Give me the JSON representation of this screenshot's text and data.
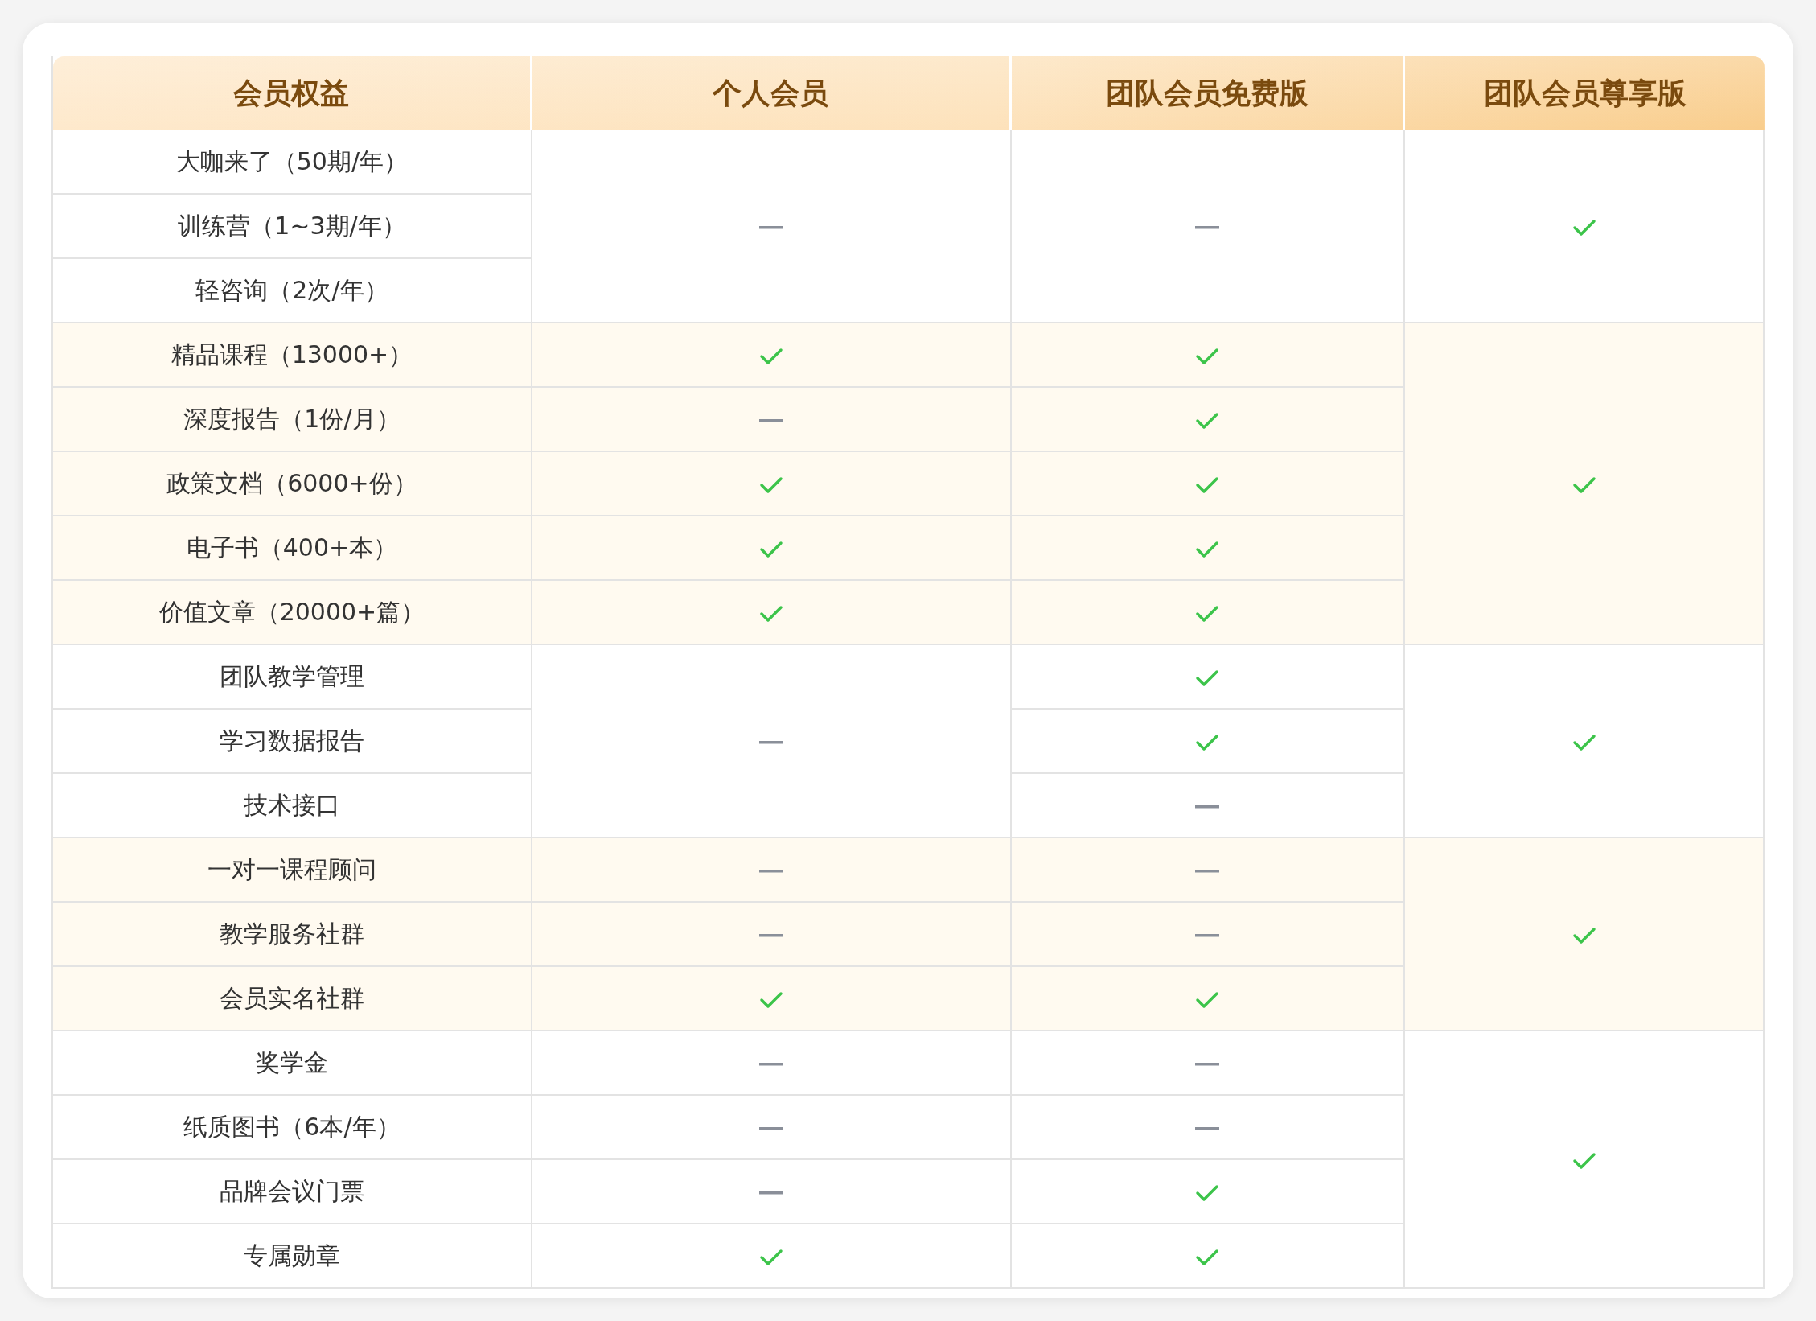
{
  "columns": [
    "会员权益",
    "个人会员",
    "团队会员免费版",
    "团队会员尊享版"
  ],
  "groups": [
    {
      "shaded": false,
      "benefits": [
        "大咖来了（50期/年）",
        "训练营（1~3期/年）",
        "轻咨询（2次/年）"
      ],
      "personal": [
        false
      ],
      "team_free": [
        false
      ],
      "team_premium": [
        true
      ]
    },
    {
      "shaded": true,
      "benefits": [
        "精品课程（13000+）",
        "深度报告（1份/月）",
        "政策文档（6000+份）",
        "电子书（400+本）",
        "价值文章（20000+篇）"
      ],
      "personal": [
        true,
        false,
        true,
        true,
        true
      ],
      "team_free": [
        true,
        true,
        true,
        true,
        true
      ],
      "team_premium": [
        true
      ]
    },
    {
      "shaded": false,
      "benefits": [
        "团队教学管理",
        "学习数据报告",
        "技术接口"
      ],
      "personal": [
        false
      ],
      "team_free": [
        true,
        true,
        false
      ],
      "team_premium": [
        true
      ]
    },
    {
      "shaded": true,
      "benefits": [
        "一对一课程顾问",
        "教学服务社群",
        "会员实名社群"
      ],
      "personal": [
        false,
        false,
        true
      ],
      "team_free": [
        false,
        false,
        true
      ],
      "team_premium": [
        true
      ]
    },
    {
      "shaded": false,
      "benefits": [
        "奖学金",
        "纸质图书（6本/年）",
        "品牌会议门票",
        "专属勋章"
      ],
      "personal": [
        false,
        false,
        false,
        true
      ],
      "team_free": [
        false,
        false,
        true,
        true
      ],
      "team_premium": [
        true
      ]
    }
  ]
}
